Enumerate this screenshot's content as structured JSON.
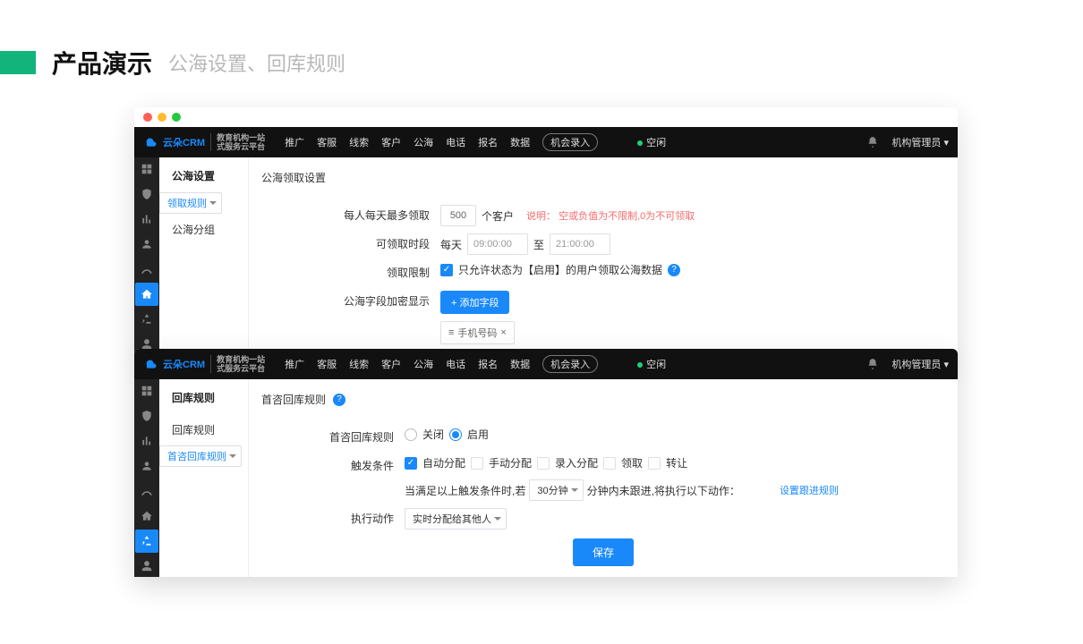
{
  "slide": {
    "title": "产品演示",
    "subtitle": "公海设置、回库规则"
  },
  "nav": {
    "brand": "云朵CRM",
    "brand_sub": "教育机构一站\n式服务云平台",
    "items": [
      "推广",
      "客服",
      "线索",
      "客户",
      "公海",
      "电话",
      "报名",
      "数据"
    ],
    "pill": "机会录入",
    "status": "空闲",
    "user": "机构管理员"
  },
  "win1": {
    "side_title": "公海设置",
    "side_items": [
      "领取规则",
      "公海分组"
    ],
    "side_selected": 0,
    "content_title": "公海领取设置",
    "rows": {
      "max_label": "每人每天最多领取",
      "max_value": "500",
      "max_unit": "个客户",
      "max_note": "说明： 空或负值为不限制,0为不可领取",
      "time_label": "可领取时段",
      "time_daily": "每天",
      "time_from": "09:00:00",
      "time_to_lbl": "至",
      "time_to": "21:00:00",
      "limit_label": "领取限制",
      "limit_text": "只允许状态为【启用】的用户领取公海数据",
      "mask_label": "公海字段加密显示",
      "mask_btn": "+ 添加字段",
      "mask_tag": "手机号码",
      "mask_tag_icon": "≡",
      "mask_tag_close": "×"
    }
  },
  "win2": {
    "side_title": "回库规则",
    "side_items": [
      "回库规则",
      "首咨回库规则"
    ],
    "side_selected": 1,
    "content_title": "首咨回库规则",
    "rows": {
      "rule_label": "首咨回库规则",
      "radio_off": "关闭",
      "radio_on": "启用",
      "trig_label": "触发条件",
      "trig_opts": [
        "自动分配",
        "手动分配",
        "录入分配",
        "领取",
        "转让"
      ],
      "trig_checked": [
        true,
        false,
        false,
        false,
        false
      ],
      "cond_pre": "当满足以上触发条件时,若",
      "cond_sel": "30分钟",
      "cond_post": "分钟内未跟进,将执行以下动作：",
      "cond_link": "设置跟进规则",
      "act_label": "执行动作",
      "act_sel": "实时分配给其他人",
      "save": "保存"
    }
  }
}
